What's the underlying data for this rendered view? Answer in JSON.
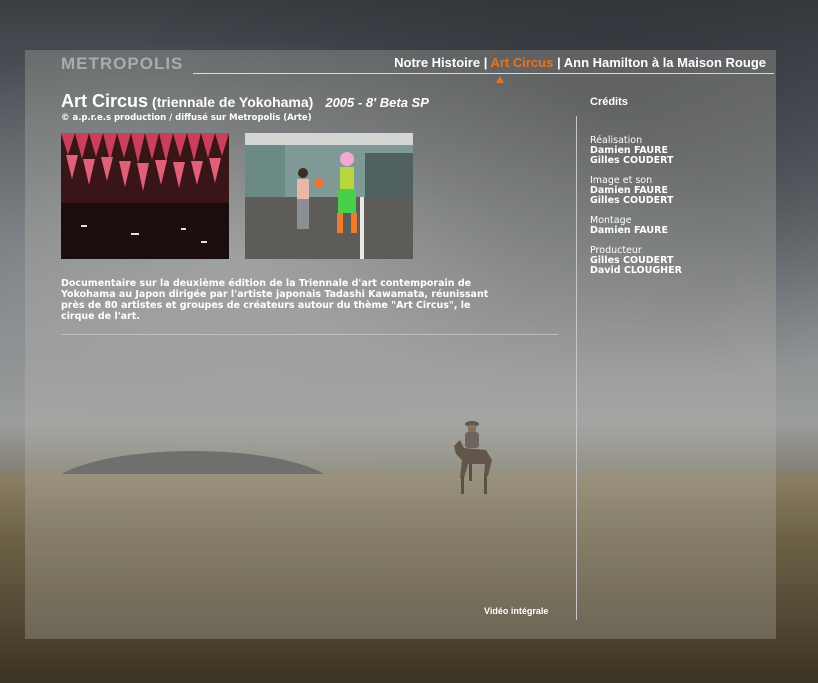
{
  "site": {
    "brand": "METROPOLIS"
  },
  "nav": {
    "items": [
      "Notre Histoire",
      "Art Circus",
      "Ann Hamilton à la Maison Rouge"
    ],
    "separator": "|",
    "active_index": 1
  },
  "film": {
    "title": "Art Circus",
    "subtitle": "(triennale de Yokohama)",
    "meta": "2005 - 8' Beta SP",
    "production": "© a.p.r.e.s production / diffusé sur Metropolis (Arte)",
    "description": "Documentaire sur la deuxième édition de la Triennale d'art contemporain de Yokohama au Japon dirigée par l'artiste japonais Tadashi Kawamata, réunissant près de 80 artistes et groupes de créateurs autour du thème \"Art Circus\", le cirque de l'art."
  },
  "credits": {
    "title": "Crédits",
    "groups": [
      {
        "role": "Réalisation",
        "names": [
          "Damien FAURE",
          "Gilles COUDERT"
        ]
      },
      {
        "role": "Image et son",
        "names": [
          "Damien FAURE",
          "Gilles COUDERT"
        ]
      },
      {
        "role": "Montage",
        "names": [
          "Damien FAURE"
        ]
      },
      {
        "role": "Producteur",
        "names": [
          "Gilles COUDERT",
          "David CLOUGHER"
        ]
      }
    ]
  },
  "video_link": "Vidéo intégrale",
  "colors": {
    "accent": "#e8731c",
    "text": "#ffffff",
    "brand": "#a9abad"
  }
}
